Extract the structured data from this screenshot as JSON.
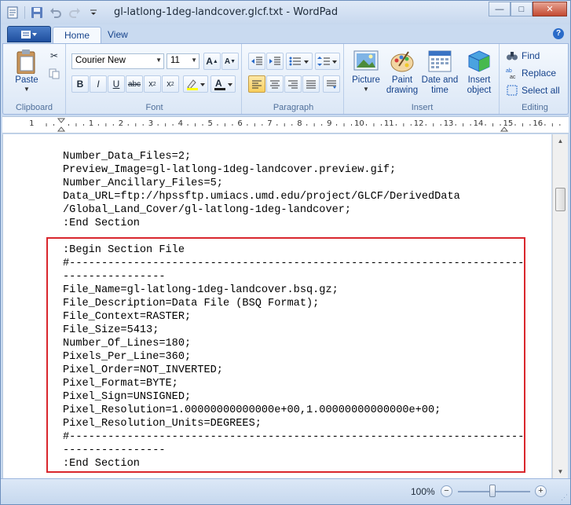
{
  "window": {
    "title": "gl-latlong-1deg-landcover.glcf.txt - WordPad",
    "controls": {
      "minimize": "—",
      "maximize": "□",
      "close": "✕"
    }
  },
  "tabs": [
    {
      "label": "Home",
      "active": true
    },
    {
      "label": "View",
      "active": false
    }
  ],
  "help_label": "?",
  "ribbon": {
    "clipboard": {
      "group_label": "Clipboard",
      "paste_label": "Paste"
    },
    "font": {
      "group_label": "Font",
      "family": "Courier New",
      "size": "11"
    },
    "paragraph": {
      "group_label": "Paragraph"
    },
    "insert": {
      "group_label": "Insert",
      "picture_label": "Picture",
      "paint_label": "Paint drawing",
      "datetime_label": "Date and time",
      "object_label": "Insert object"
    },
    "editing": {
      "group_label": "Editing",
      "find_label": "Find",
      "replace_label": "Replace",
      "selectall_label": "Select all"
    }
  },
  "ruler": [
    "1",
    "2",
    "3",
    "4",
    "5",
    "6",
    "7",
    "8",
    "9",
    "10",
    "11",
    "12",
    "13",
    "14",
    "15",
    "16"
  ],
  "document": {
    "lines": [
      "Number_Data_Files=2;",
      "Preview_Image=gl-latlong-1deg-landcover.preview.gif;",
      "Number_Ancillary_Files=5;",
      "Data_URL=ftp://hpssftp.umiacs.umd.edu/project/GLCF/DerivedData",
      "/Global_Land_Cover/gl-latlong-1deg-landcover;",
      ":End Section",
      "",
      ":Begin Section File",
      "#-----------------------------------------------------------------------",
      "----------------",
      "File_Name=gl-latlong-1deg-landcover.bsq.gz;",
      "File_Description=Data File (BSQ Format);",
      "File_Context=RASTER;",
      "File_Size=5413;",
      "Number_Of_Lines=180;",
      "Pixels_Per_Line=360;",
      "Pixel_Order=NOT_INVERTED;",
      "Pixel_Format=BYTE;",
      "Pixel_Sign=UNSIGNED;",
      "Pixel_Resolution=1.00000000000000e+00,1.00000000000000e+00;",
      "Pixel_Resolution_Units=DEGREES;",
      "#-----------------------------------------------------------------------",
      "----------------",
      ":End Section"
    ]
  },
  "statusbar": {
    "zoom": "100%"
  },
  "colors": {
    "highlight_box": "#d9272d",
    "ribbon_bg": "#dbe7f6"
  }
}
